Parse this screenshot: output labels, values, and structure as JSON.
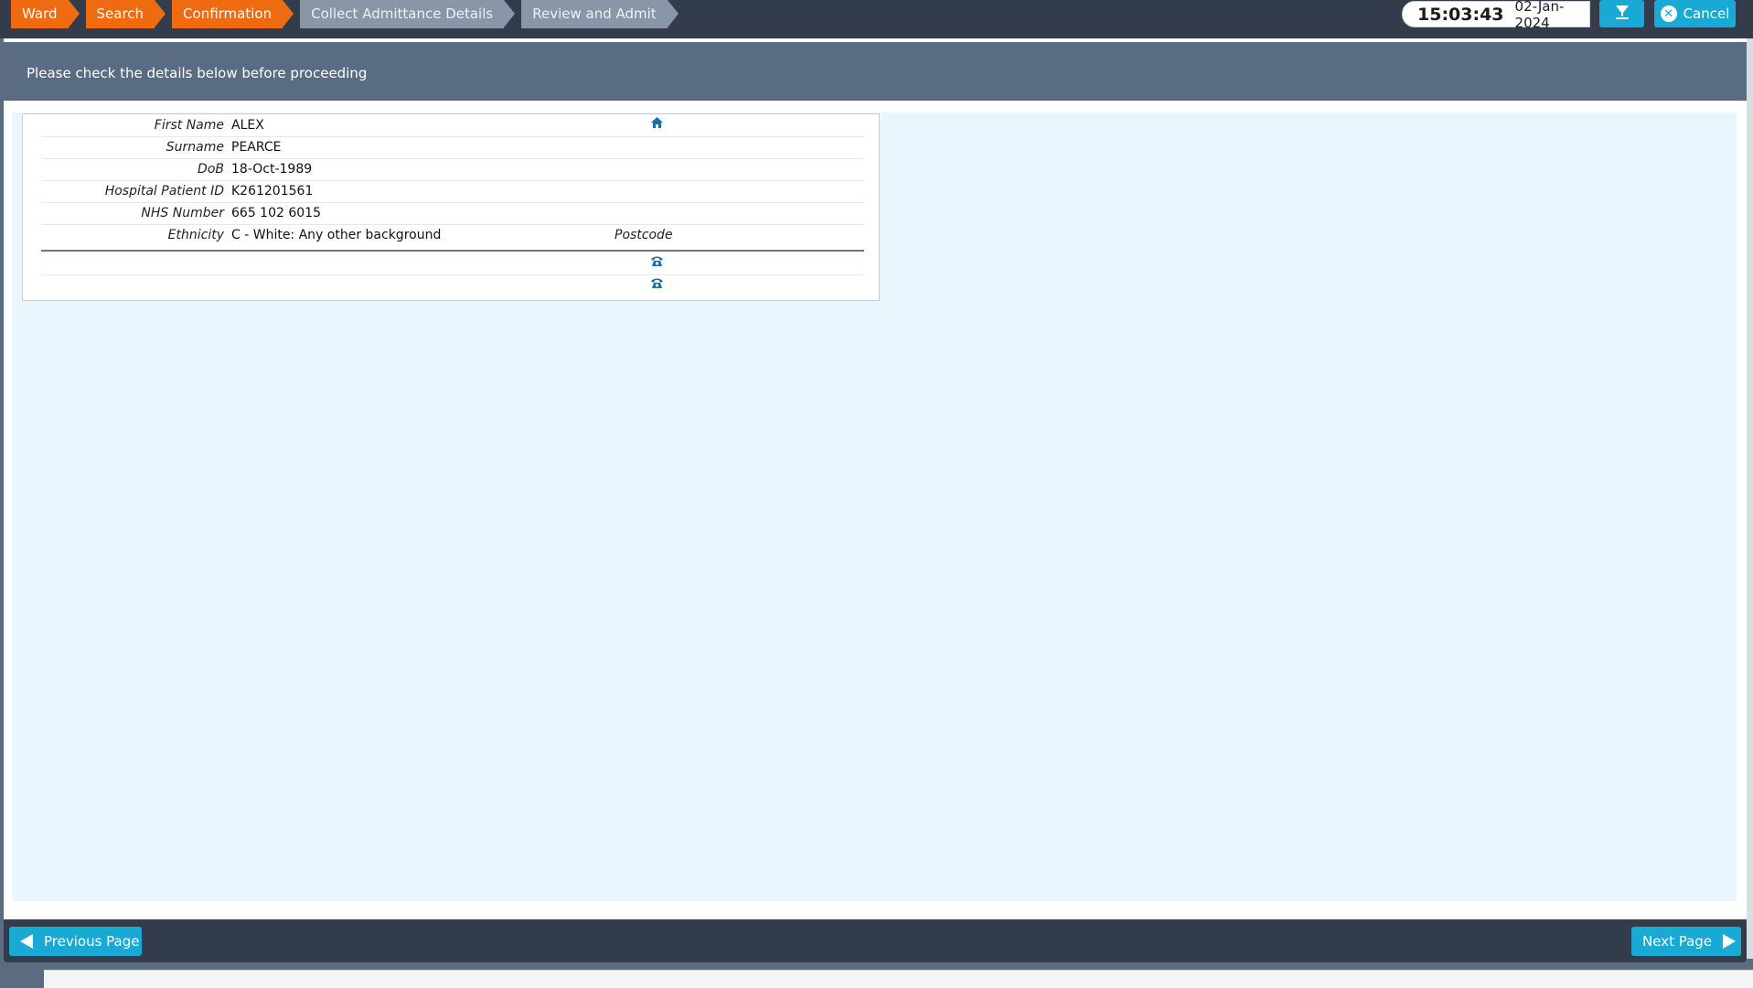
{
  "breadcrumbs": [
    {
      "label": "Ward",
      "state": "done"
    },
    {
      "label": "Search",
      "state": "done"
    },
    {
      "label": "Confirmation",
      "state": "done"
    },
    {
      "label": "Collect Admittance Details",
      "state": "todo"
    },
    {
      "label": "Review and Admit",
      "state": "todo"
    }
  ],
  "clock": {
    "time": "15:03:43",
    "date": "02-Jan-2024"
  },
  "toolbar": {
    "filter_icon": "filter-down-icon",
    "cancel_label": "Cancel",
    "cancel_icon": "close-circle-icon"
  },
  "header": {
    "message": "Please check the details below before proceeding"
  },
  "patient": {
    "fields": [
      {
        "label": "First Name",
        "value": "ALEX"
      },
      {
        "label": "Surname",
        "value": "PEARCE"
      },
      {
        "label": "DoB",
        "value": "18-Oct-1989"
      },
      {
        "label": "Hospital Patient ID",
        "value": "K261201561"
      },
      {
        "label": "NHS Number",
        "value": "665 102 6015"
      },
      {
        "label": "Ethnicity",
        "value": "C - White: Any other background"
      }
    ],
    "postcode_label": "Postcode",
    "address_icon": "home-icon",
    "phone_icon": "phone-icon"
  },
  "footer": {
    "previous_label": "Previous Page",
    "next_label": "Next Page"
  },
  "colors": {
    "done": "#ef6b12",
    "todo": "#8896a8",
    "accent": "#18a9d4",
    "bar": "#323c4a",
    "band": "#5a6c84"
  }
}
